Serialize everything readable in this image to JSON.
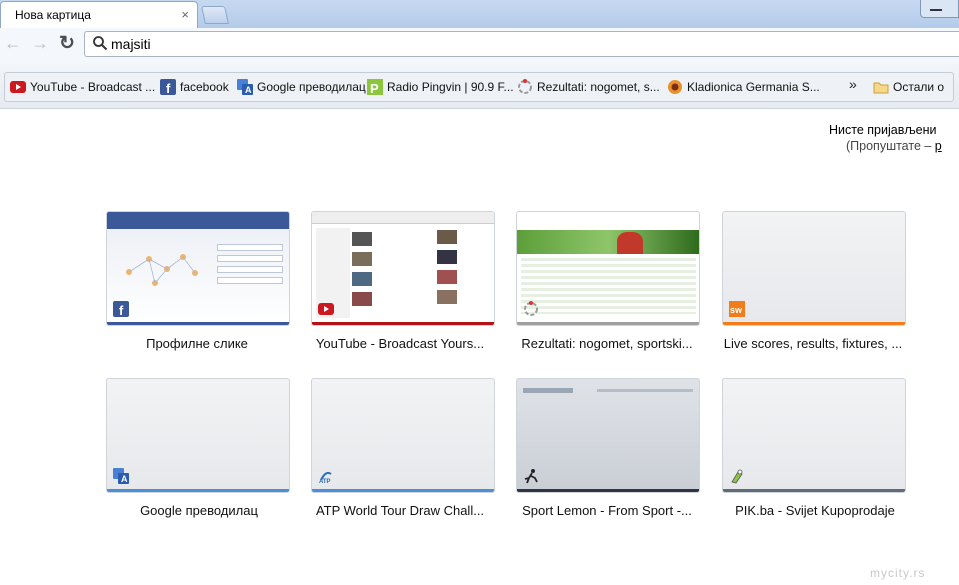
{
  "tab": {
    "title": "Нова картица",
    "close": "×"
  },
  "toolbar": {
    "back": "←",
    "forward": "→",
    "reload": "↻",
    "omnibox_value": "majsiti"
  },
  "bookmarks": [
    {
      "label": "YouTube - Broadcast ...",
      "icon": "youtube-icon"
    },
    {
      "label": "facebook",
      "icon": "facebook-icon"
    },
    {
      "label": "Google преводилац",
      "icon": "google-translate-icon"
    },
    {
      "label": "Radio Pingvin | 90.9 F...",
      "icon": "radio-pingvin-icon"
    },
    {
      "label": "Rezultati: nogomet, s...",
      "icon": "rezultati-icon"
    },
    {
      "label": "Kladionica Germania S...",
      "icon": "germania-icon"
    }
  ],
  "bookmarks_more": "»",
  "other_bookmarks": "Остали о",
  "signin": {
    "line1": "Нисте пријављени",
    "line2_prefix": "(Пропуштате – ",
    "line2_link": "р"
  },
  "thumbnails": [
    {
      "label": "Профилне слике",
      "accent": "#3b5998"
    },
    {
      "label": "YouTube - Broadcast Yours...",
      "accent": "#b31217"
    },
    {
      "label": "Rezultati: nogomet, sportski...",
      "accent": "#a0a0a0"
    },
    {
      "label": "Live scores, results, fixtures, ...",
      "accent": "#f07c1a"
    },
    {
      "label": "Google преводилац",
      "accent": "#4a90d9"
    },
    {
      "label": "ATP World Tour Draw Chall...",
      "accent": "#4a90d9"
    },
    {
      "label": "Sport Lemon - From Sport -...",
      "accent": "#2f3542"
    },
    {
      "label": "PIK.ba - Svijet Kupoprodaje",
      "accent": "#5f6b77"
    }
  ],
  "watermark": "mycity.rs"
}
